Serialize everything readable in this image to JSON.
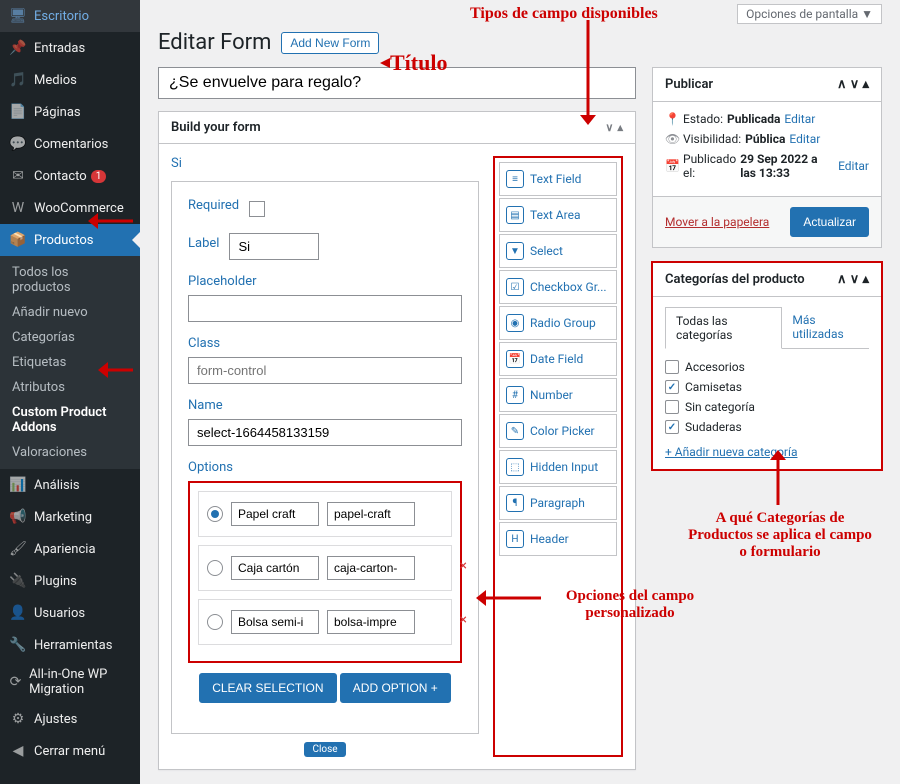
{
  "topbar": {
    "screen_options": "Opciones de pantalla ▼"
  },
  "header": {
    "title": "Editar Form",
    "add_new": "Add New Form"
  },
  "title_input": "¿Se envuelve para regalo?",
  "anno": {
    "titulo": "Título",
    "tipos": "Tipos de campo disponibles",
    "opciones": "Opciones del campo personalizado",
    "cats": "A qué Categorías de Productos se aplica el campo o formulario"
  },
  "build_panel": {
    "title": "Build your form"
  },
  "selected": {
    "heading": "Si",
    "required_label": "Required",
    "label_label": "Label",
    "label_value": "Si",
    "placeholder_label": "Placeholder",
    "class_label": "Class",
    "class_placeholder": "form-control",
    "name_label": "Name",
    "name_value": "select-1664458133159",
    "options_label": "Options",
    "clear_btn": "CLEAR SELECTION",
    "add_btn": "ADD OPTION +",
    "close": "Close"
  },
  "options": [
    {
      "label": "Papel craft",
      "value": "papel-craft",
      "checked": true,
      "del": false
    },
    {
      "label": "Caja cartón",
      "value": "caja-carton-",
      "checked": false,
      "del": true
    },
    {
      "label": "Bolsa semi-i",
      "value": "bolsa-impre",
      "checked": false,
      "del": true
    }
  ],
  "palette": [
    {
      "icon": "≡",
      "label": "Text Field"
    },
    {
      "icon": "▤",
      "label": "Text Area"
    },
    {
      "icon": "▼",
      "label": "Select"
    },
    {
      "icon": "☑",
      "label": "Checkbox Gr..."
    },
    {
      "icon": "◉",
      "label": "Radio Group"
    },
    {
      "icon": "📅",
      "label": "Date Field"
    },
    {
      "icon": "#",
      "label": "Number"
    },
    {
      "icon": "✎",
      "label": "Color Picker"
    },
    {
      "icon": "⬚",
      "label": "Hidden Input"
    },
    {
      "icon": "¶",
      "label": "Paragraph"
    },
    {
      "icon": "H",
      "label": "Header"
    }
  ],
  "publish": {
    "title": "Publicar",
    "status_label": "Estado:",
    "status_value": "Publicada",
    "vis_label": "Visibilidad:",
    "vis_value": "Pública",
    "pub_label": "Publicado el:",
    "pub_value": "29 Sep 2022 a las 13:33",
    "edit": "Editar",
    "trash": "Mover a la papelera",
    "update": "Actualizar"
  },
  "cats": {
    "title": "Categorías del producto",
    "tab_all": "Todas las categorías",
    "tab_most": "Más utilizadas",
    "items": [
      {
        "label": "Accesorios",
        "checked": false
      },
      {
        "label": "Camisetas",
        "checked": true
      },
      {
        "label": "Sin categoría",
        "checked": false
      },
      {
        "label": "Sudaderas",
        "checked": true
      }
    ],
    "add": "+ Añadir nueva categoría"
  },
  "sidebar": {
    "items": [
      {
        "icon": "🖥",
        "label": "Escritorio"
      },
      {
        "icon": "📌",
        "label": "Entradas"
      },
      {
        "icon": "🎵",
        "label": "Medios"
      },
      {
        "icon": "📄",
        "label": "Páginas"
      },
      {
        "icon": "💬",
        "label": "Comentarios"
      },
      {
        "icon": "✉",
        "label": "Contacto",
        "badge": "1"
      },
      {
        "icon": "W",
        "label": "WooCommerce"
      },
      {
        "icon": "📦",
        "label": "Productos",
        "active": true
      }
    ],
    "sub": [
      {
        "label": "Todos los productos"
      },
      {
        "label": "Añadir nuevo"
      },
      {
        "label": "Categorías"
      },
      {
        "label": "Etiquetas"
      },
      {
        "label": "Atributos"
      },
      {
        "label": "Custom Product Addons",
        "bold": true
      },
      {
        "label": "Valoraciones"
      }
    ],
    "rest": [
      {
        "icon": "📊",
        "label": "Análisis"
      },
      {
        "icon": "📢",
        "label": "Marketing"
      },
      {
        "icon": "🖌",
        "label": "Apariencia"
      },
      {
        "icon": "🔌",
        "label": "Plugins"
      },
      {
        "icon": "👤",
        "label": "Usuarios"
      },
      {
        "icon": "🔧",
        "label": "Herramientas"
      },
      {
        "icon": "⟳",
        "label": "All-in-One WP Migration"
      },
      {
        "icon": "⚙",
        "label": "Ajustes"
      },
      {
        "icon": "◀",
        "label": "Cerrar menú"
      }
    ]
  }
}
